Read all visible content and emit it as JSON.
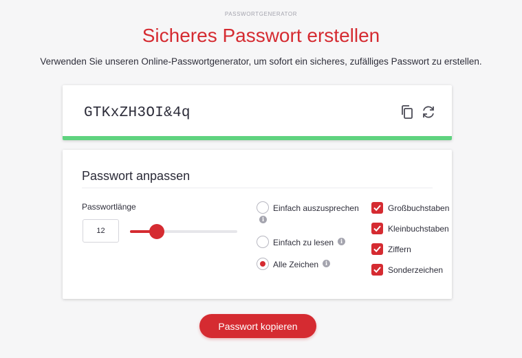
{
  "header": {
    "eyebrow": "PASSWORTGENERATOR",
    "title": "Sicheres Passwort erstellen",
    "subtitle": "Verwenden Sie unseren Online-Passwortgenerator, um sofort ein sicheres, zufälliges Passwort zu erstellen."
  },
  "password": {
    "value": "GTKxZH3OI&4q",
    "strength": 1.0,
    "strength_color": "#5fd37f",
    "copy_icon": "copy-icon",
    "refresh_icon": "refresh-icon"
  },
  "options": {
    "title": "Passwort anpassen",
    "length_label": "Passwortlänge",
    "length_value": "12",
    "slider_fraction": 0.25,
    "radios": [
      {
        "label": "Einfach auszusprechen",
        "checked": false
      },
      {
        "label": "Einfach zu lesen",
        "checked": false
      },
      {
        "label": "Alle Zeichen",
        "checked": true
      }
    ],
    "checkboxes": [
      {
        "label": "Großbuchstaben",
        "checked": true
      },
      {
        "label": "Kleinbuchstaben",
        "checked": true
      },
      {
        "label": "Ziffern",
        "checked": true
      },
      {
        "label": "Sonderzeichen",
        "checked": true
      }
    ],
    "info_glyph": "i"
  },
  "actions": {
    "copy_label": "Passwort kopieren"
  },
  "colors": {
    "accent": "#d52b31",
    "background": "#f6f6f7"
  }
}
